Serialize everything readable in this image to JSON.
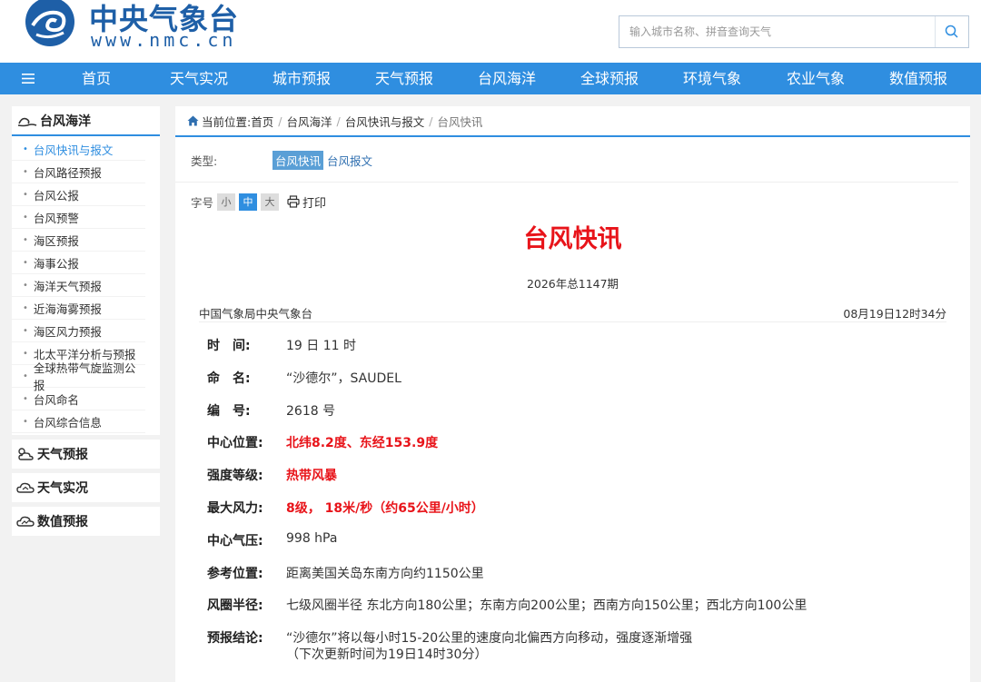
{
  "header": {
    "logo_cn": "中央气象台",
    "logo_url": "www.nmc.cn",
    "search_placeholder": "输入城市名称、拼音查询天气"
  },
  "nav": {
    "items": [
      "首页",
      "天气实况",
      "城市预报",
      "天气预报",
      "台风海洋",
      "全球预报",
      "环境气象",
      "农业气象",
      "数值预报"
    ]
  },
  "sidebar": {
    "section_title": "台风海洋",
    "items": [
      "台风快讯与报文",
      "台风路径预报",
      "台风公报",
      "台风预警",
      "海区预报",
      "海事公报",
      "海洋天气预报",
      "近海海雾预报",
      "海区风力预报",
      "北太平洋分析与预报",
      "全球热带气旋监测公报",
      "台风命名",
      "台风综合信息"
    ],
    "blocks": [
      "天气预报",
      "天气实况",
      "数值预报"
    ]
  },
  "breadcrumb": {
    "prefix": "当前位置:",
    "items": [
      "首页",
      "台风海洋",
      "台风快讯与报文"
    ],
    "current": "台风快讯"
  },
  "type_row": {
    "label": "类型:",
    "active": "台风快讯",
    "other": "台风报文"
  },
  "font_row": {
    "label": "字号",
    "sizes": [
      "小",
      "中",
      "大"
    ],
    "print": "打印"
  },
  "article": {
    "title": "台风快讯",
    "issue": "2026年总1147期",
    "source": "中国气象局中央气象台",
    "time": "08月19日12时34分",
    "rows": [
      {
        "k": "时　间:",
        "v": "19 日 11 时"
      },
      {
        "k": "命　名:",
        "v": "“沙德尔”，SAUDEL"
      },
      {
        "k": "编　号:",
        "v": "2618 号"
      },
      {
        "k": "中心位置:",
        "v": "北纬8.2度、东经153.9度"
      },
      {
        "k": "强度等级:",
        "v": "热带风暴"
      },
      {
        "k": "最大风力:",
        "v": "8级， 18米/秒（约65公里/小时）"
      },
      {
        "k": "中心气压:",
        "v": "998 hPa"
      },
      {
        "k": "参考位置:",
        "v": "距离美国关岛东南方向约1150公里"
      },
      {
        "k": "风圈半径:",
        "v": "七级风圈半径 东北方向180公里；东南方向200公里；西南方向150公里；西北方向100公里"
      },
      {
        "k": "预报结论:",
        "v": "“沙德尔”将以每小时15-20公里的速度向北偏西方向移动，强度逐渐增强",
        "v2": "（下次更新时间为19日14时30分）"
      }
    ]
  },
  "colors": {
    "brand_blue": "#1e5fa7",
    "nav_blue": "#2f8ee0",
    "alert_red": "#e8141a"
  }
}
